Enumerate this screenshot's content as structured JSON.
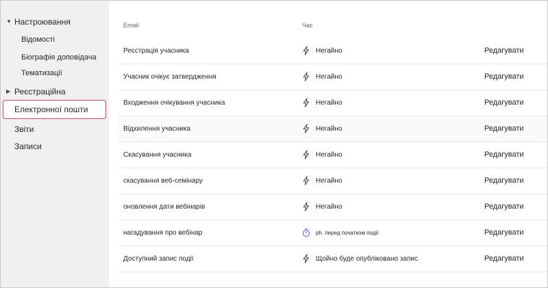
{
  "sidebar": {
    "items": [
      {
        "label": "Настроювання",
        "caret": "▼"
      },
      {
        "label": "Відомості"
      },
      {
        "label": "Біографія доповідача"
      },
      {
        "label": "Тематизації"
      },
      {
        "label": "Реєстраційна",
        "caret": "▶"
      },
      {
        "label": "Електронної пошти"
      },
      {
        "label": "Звіти"
      },
      {
        "label": "Записи"
      }
    ]
  },
  "table": {
    "headers": {
      "email": "Email",
      "time": "Час"
    },
    "rows": [
      {
        "email": "Реєстрація учасника",
        "icon": "lightning-icon",
        "time": "Негайно",
        "action": "Редагувати"
      },
      {
        "email": "Учасник очікує затвердження",
        "icon": "lightning-icon",
        "time": "Негайно",
        "action": "Редагувати"
      },
      {
        "email": "Входження очікування учасника",
        "icon": "lightning-icon",
        "time": "Негайно",
        "action": "Редагувати"
      },
      {
        "email": "Відхилення учасника",
        "icon": "lightning-icon",
        "time": "Негайно",
        "action": "Редагувати"
      },
      {
        "email": "Скасування учасника",
        "icon": "lightning-icon",
        "time": "Негайно",
        "action": "Редагувати"
      },
      {
        "email": "скасування веб-семінару",
        "icon": "lightning-icon",
        "time": "Негайно",
        "action": "Редагувати"
      },
      {
        "email": "оновлення дати вебінарів",
        "icon": "lightning-icon",
        "time": "Негайно",
        "action": "Редагувати"
      },
      {
        "email": "нагадування про вебінар",
        "icon": "timer-icon",
        "time": "ph. перед початком події",
        "action": "Редагувати"
      },
      {
        "email": "Доступний запис події",
        "icon": "lightning-icon",
        "time": "Щойно буде опубліковано запис",
        "action": "Редагувати"
      }
    ]
  },
  "colors": {
    "selected_border": "#e04455",
    "timer_icon": "#8b5cf6"
  }
}
